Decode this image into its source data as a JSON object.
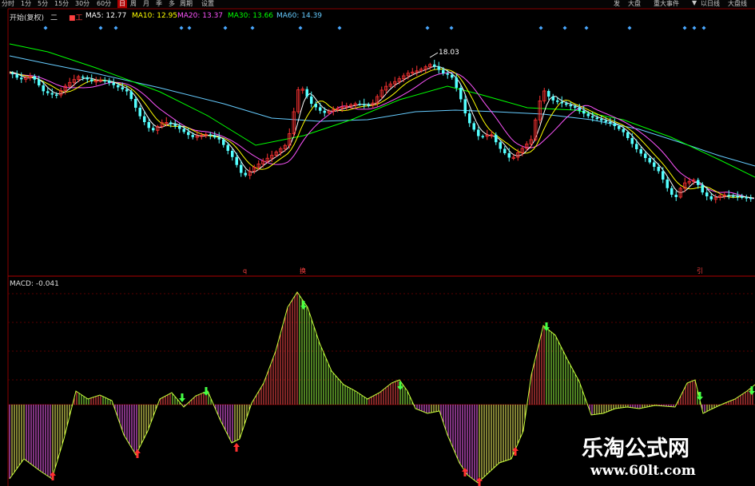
{
  "toolbar": {
    "left_items": [
      "分时",
      "1分",
      "5分",
      "15分",
      "30分",
      "60分",
      "日",
      "周",
      "月",
      "季",
      "多",
      "周期",
      "设置"
    ],
    "active_index": 6,
    "right_items": [
      "发",
      "大盘",
      "重大事件",
      "▼",
      "以日线",
      "大盘线"
    ]
  },
  "main_chart": {
    "stock_label": "开始(复权)",
    "legend": [
      {
        "label": "MA5: 12.77",
        "color": "#ffffff"
      },
      {
        "label": "MA10: 12.95",
        "color": "#ffff00"
      },
      {
        "label": "MA20: 13.37",
        "color": "#ff55ff"
      },
      {
        "label": "MA30: 13.66",
        "color": "#00ff00"
      },
      {
        "label": "MA60: 14.39",
        "color": "#66ccff"
      }
    ],
    "high_label": "18.03",
    "marker_labels": [
      "q",
      "换",
      "引"
    ]
  },
  "macd_panel": {
    "label": "MACD: -0.041"
  },
  "watermark": {
    "line1": "乐淘公式网",
    "line2": "www.60lt.com"
  },
  "colors": {
    "up": "#ff3232",
    "down": "#54ffff",
    "ma5": "#ffffff",
    "ma10": "#ffff00",
    "ma20": "#ff55ff",
    "ma30": "#00ff00",
    "ma60": "#66ccff",
    "grid": "#8b0000"
  }
}
